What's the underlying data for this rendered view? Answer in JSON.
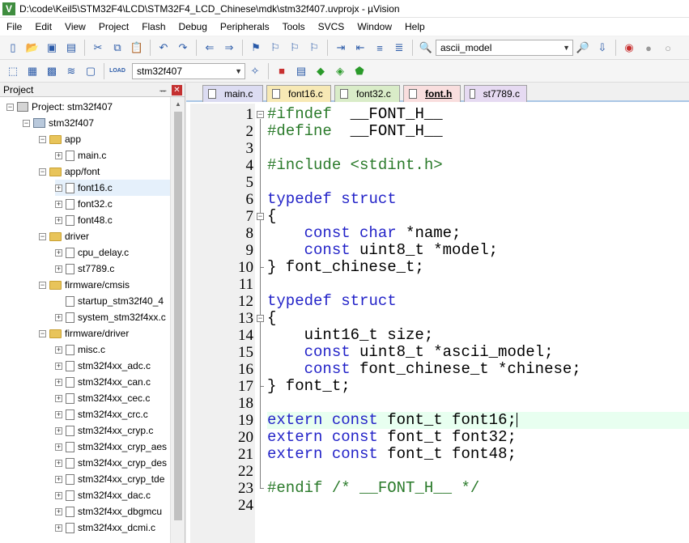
{
  "window": {
    "title": "D:\\code\\Keil5\\STM32F4\\LCD\\STM32F4_LCD_Chinese\\mdk\\stm32f407.uvprojx - µVision",
    "icon": "uvision-app-icon"
  },
  "menu": [
    "File",
    "Edit",
    "View",
    "Project",
    "Flash",
    "Debug",
    "Peripherals",
    "Tools",
    "SVCS",
    "Window",
    "Help"
  ],
  "toolbar1": {
    "find_combo_value": "ascii_model"
  },
  "toolbar2": {
    "load_label": "LOAD",
    "target_combo_value": "stm32f407"
  },
  "project_panel": {
    "title": "Project",
    "pin": "ᅲ",
    "close": "✕",
    "tree": [
      {
        "label": "Project: stm32f407",
        "kind": "proj",
        "level": 0,
        "exp": "−"
      },
      {
        "label": "stm32f407",
        "kind": "tgt",
        "level": 1,
        "exp": "−"
      },
      {
        "label": "app",
        "kind": "folder",
        "level": 2,
        "exp": "−"
      },
      {
        "label": "main.c",
        "kind": "file",
        "level": 3,
        "exp": "+"
      },
      {
        "label": "app/font",
        "kind": "folder",
        "level": 2,
        "exp": "−"
      },
      {
        "label": "font16.c",
        "kind": "file",
        "level": 3,
        "exp": "+",
        "selected": true
      },
      {
        "label": "font32.c",
        "kind": "file",
        "level": 3,
        "exp": "+"
      },
      {
        "label": "font48.c",
        "kind": "file",
        "level": 3,
        "exp": "+"
      },
      {
        "label": "driver",
        "kind": "folder",
        "level": 2,
        "exp": "−"
      },
      {
        "label": "cpu_delay.c",
        "kind": "file",
        "level": 3,
        "exp": "+"
      },
      {
        "label": "st7789.c",
        "kind": "file",
        "level": 3,
        "exp": "+"
      },
      {
        "label": "firmware/cmsis",
        "kind": "folder",
        "level": 2,
        "exp": "−"
      },
      {
        "label": "startup_stm32f40_4",
        "kind": "file",
        "level": 3,
        "exp": ""
      },
      {
        "label": "system_stm32f4xx.c",
        "kind": "file",
        "level": 3,
        "exp": "+"
      },
      {
        "label": "firmware/driver",
        "kind": "folder",
        "level": 2,
        "exp": "−"
      },
      {
        "label": "misc.c",
        "kind": "file",
        "level": 3,
        "exp": "+"
      },
      {
        "label": "stm32f4xx_adc.c",
        "kind": "file",
        "level": 3,
        "exp": "+"
      },
      {
        "label": "stm32f4xx_can.c",
        "kind": "file",
        "level": 3,
        "exp": "+"
      },
      {
        "label": "stm32f4xx_cec.c",
        "kind": "file",
        "level": 3,
        "exp": "+"
      },
      {
        "label": "stm32f4xx_crc.c",
        "kind": "file",
        "level": 3,
        "exp": "+"
      },
      {
        "label": "stm32f4xx_cryp.c",
        "kind": "file",
        "level": 3,
        "exp": "+"
      },
      {
        "label": "stm32f4xx_cryp_aes",
        "kind": "file",
        "level": 3,
        "exp": "+"
      },
      {
        "label": "stm32f4xx_cryp_des",
        "kind": "file",
        "level": 3,
        "exp": "+"
      },
      {
        "label": "stm32f4xx_cryp_tde",
        "kind": "file",
        "level": 3,
        "exp": "+"
      },
      {
        "label": "stm32f4xx_dac.c",
        "kind": "file",
        "level": 3,
        "exp": "+"
      },
      {
        "label": "stm32f4xx_dbgmcu",
        "kind": "file",
        "level": 3,
        "exp": "+"
      },
      {
        "label": "stm32f4xx_dcmi.c",
        "kind": "file",
        "level": 3,
        "exp": "+"
      }
    ]
  },
  "tabs": [
    {
      "label": "main.c",
      "color": "#dcdcf2",
      "active": false
    },
    {
      "label": "font16.c",
      "color": "#f7e9b5",
      "active": false
    },
    {
      "label": "font32.c",
      "color": "#d9ecc8",
      "active": false
    },
    {
      "label": "font.h",
      "color": "#f9dede",
      "active": true
    },
    {
      "label": "st7789.c",
      "color": "#e6daf2",
      "active": false
    }
  ],
  "code": {
    "line_numbers": [
      "1",
      "2",
      "3",
      "4",
      "5",
      "6",
      "7",
      "8",
      "9",
      "10",
      "11",
      "12",
      "13",
      "14",
      "15",
      "16",
      "17",
      "18",
      "19",
      "20",
      "21",
      "22",
      "23",
      "24"
    ],
    "lines": [
      [
        [
          "pp",
          "#ifndef"
        ],
        [
          "",
          "  __FONT_H__"
        ]
      ],
      [
        [
          "pp",
          "#define"
        ],
        [
          "",
          "  __FONT_H__"
        ]
      ],
      [],
      [
        [
          "pp",
          "#include <stdint.h>"
        ]
      ],
      [],
      [
        [
          "kw",
          "typedef"
        ],
        [
          "",
          " "
        ],
        [
          "kw",
          "struct"
        ]
      ],
      [
        [
          "",
          "{"
        ]
      ],
      [
        [
          "",
          "    "
        ],
        [
          "kw",
          "const"
        ],
        [
          "",
          " "
        ],
        [
          "kw",
          "char"
        ],
        [
          "",
          " *name;"
        ]
      ],
      [
        [
          "",
          "    "
        ],
        [
          "kw",
          "const"
        ],
        [
          "",
          " uint8_t *model;"
        ]
      ],
      [
        [
          "",
          "} font_chinese_t;"
        ]
      ],
      [],
      [
        [
          "kw",
          "typedef"
        ],
        [
          "",
          " "
        ],
        [
          "kw",
          "struct"
        ]
      ],
      [
        [
          "",
          "{"
        ]
      ],
      [
        [
          "",
          "    uint16_t size;"
        ]
      ],
      [
        [
          "",
          "    "
        ],
        [
          "kw",
          "const"
        ],
        [
          "",
          " uint8_t *ascii_model;"
        ]
      ],
      [
        [
          "",
          "    "
        ],
        [
          "kw",
          "const"
        ],
        [
          "",
          " font_chinese_t *chinese;"
        ]
      ],
      [
        [
          "",
          "} font_t;"
        ]
      ],
      [],
      [
        [
          "kw",
          "extern"
        ],
        [
          "",
          " "
        ],
        [
          "kw",
          "const"
        ],
        [
          "",
          " font_t font16;"
        ]
      ],
      [
        [
          "kw",
          "extern"
        ],
        [
          "",
          " "
        ],
        [
          "kw",
          "const"
        ],
        [
          "",
          " font_t font32;"
        ]
      ],
      [
        [
          "kw",
          "extern"
        ],
        [
          "",
          " "
        ],
        [
          "kw",
          "const"
        ],
        [
          "",
          " font_t font48;"
        ]
      ],
      [],
      [
        [
          "pp",
          "#endif"
        ],
        [
          "cm",
          " /* __FONT_H__ */"
        ]
      ],
      []
    ],
    "current_line": 19
  }
}
